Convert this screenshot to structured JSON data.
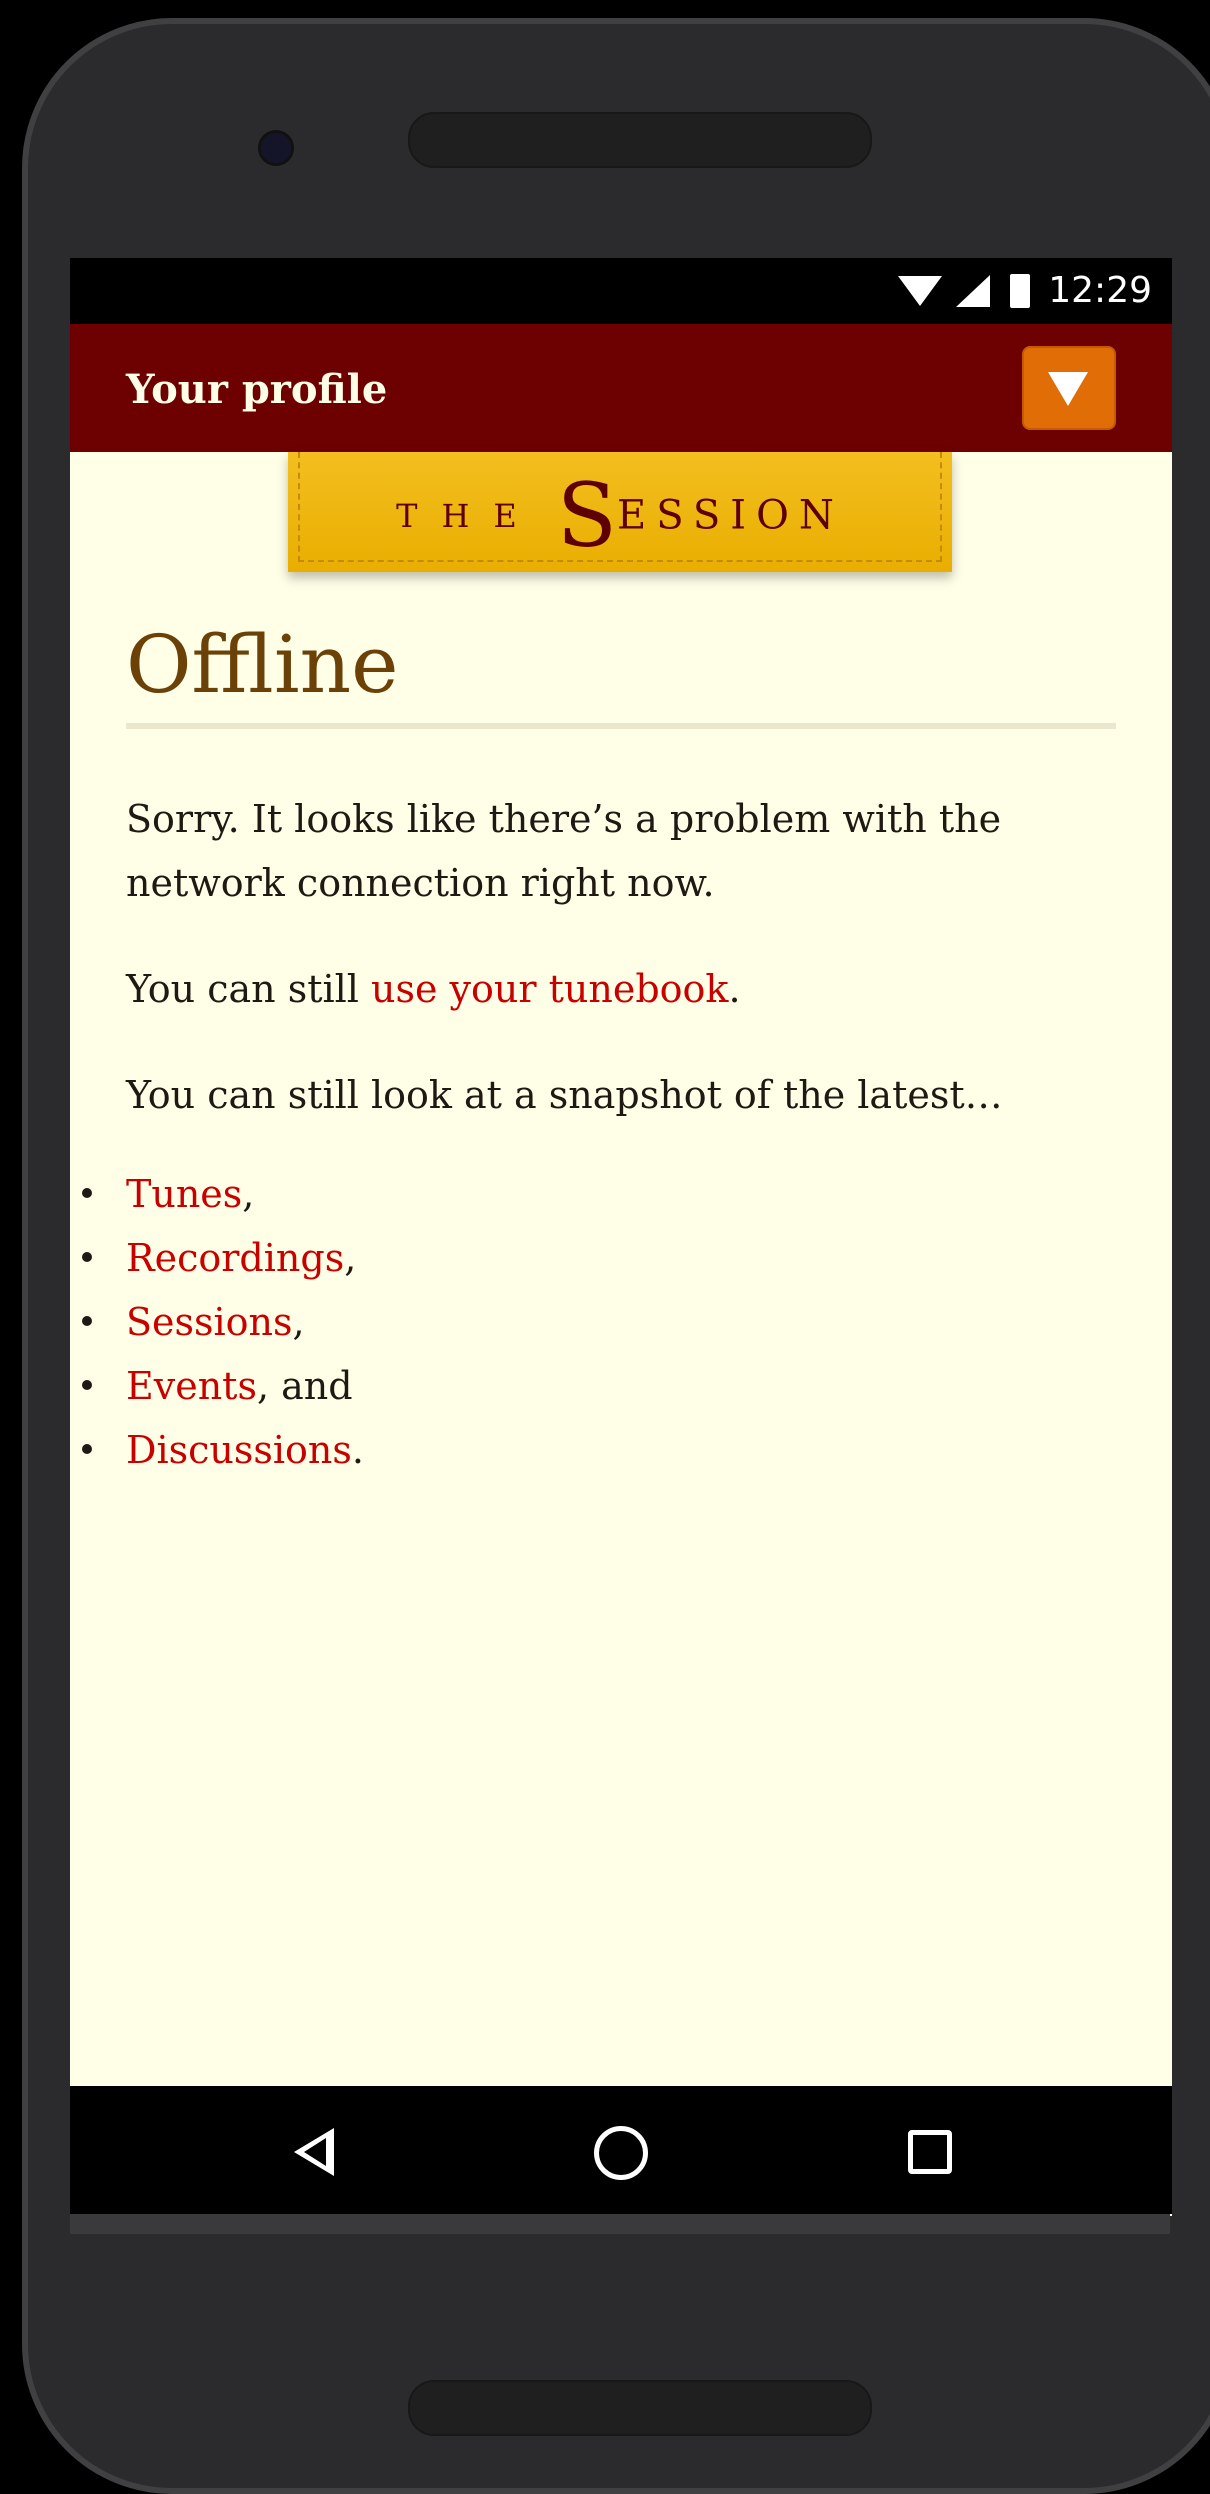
{
  "statusbar": {
    "time": "12:29"
  },
  "appbar": {
    "title": "Your profile",
    "menu_icon": "triangle-down-icon",
    "menu_color": "#e06d06",
    "bar_color": "#6d0000"
  },
  "banner": {
    "the": "THE",
    "s": "S",
    "ession": "ESSION"
  },
  "main": {
    "heading": "Offline",
    "p1": "Sorry. It looks like there’s a problem with the network connection right now.",
    "p2_prefix": "You can still ",
    "p2_link": "use your tunebook",
    "p2_suffix": ".",
    "p3": "You can still look at a snapshot of the latest…",
    "list": [
      {
        "link": "Tunes",
        "suffix": ","
      },
      {
        "link": "Recordings",
        "suffix": ","
      },
      {
        "link": "Sessions",
        "suffix": ","
      },
      {
        "link": "Events",
        "suffix": ", and"
      },
      {
        "link": "Discussions",
        "suffix": "."
      }
    ]
  },
  "colors": {
    "link": "#c80000",
    "heading": "#6b4108",
    "background": "#fffee6"
  }
}
